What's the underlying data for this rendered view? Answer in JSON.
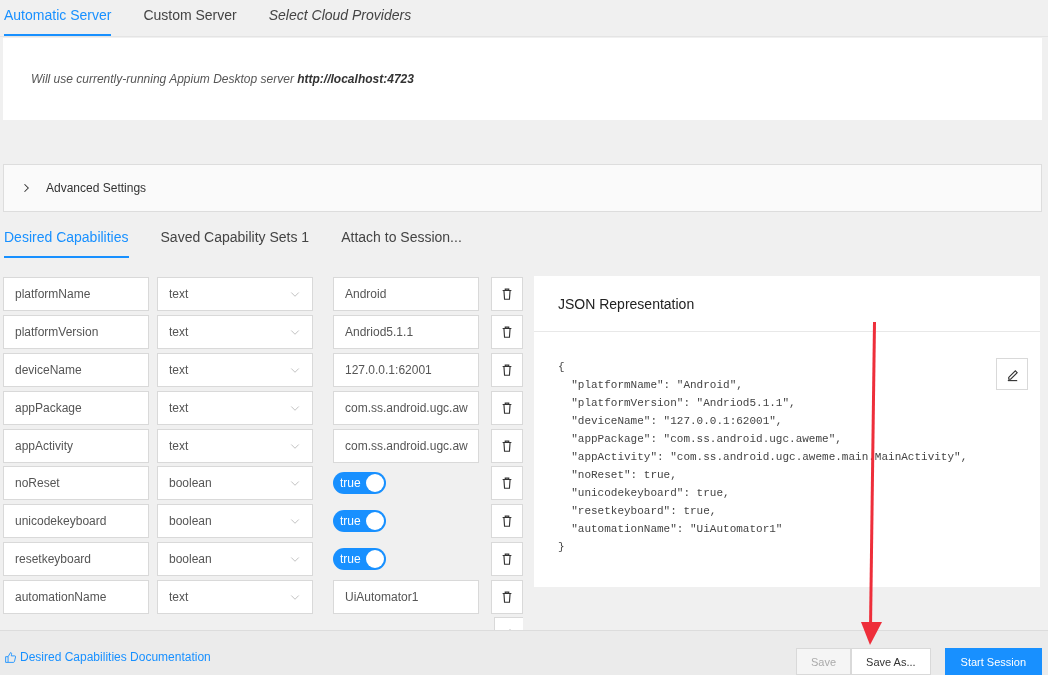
{
  "server_tabs": [
    {
      "label": "Automatic Server",
      "selected": true,
      "italic": false
    },
    {
      "label": "Custom Server",
      "selected": false,
      "italic": false
    },
    {
      "label": "Select Cloud Providers",
      "selected": false,
      "italic": true
    }
  ],
  "server_note": "Will use currently-running Appium Desktop server **http://localhost:4723**",
  "advanced_settings": {
    "label": "Advanced Settings",
    "expanded": false
  },
  "capability_tabs": [
    {
      "label": "Desired Capabilities",
      "selected": true
    },
    {
      "label": "Saved Capability Sets 1",
      "selected": false
    },
    {
      "label": "Attach to Session...",
      "selected": false
    }
  ],
  "capabilities": [
    {
      "name": "platformName",
      "type": "text",
      "kind": "field",
      "value": "Android"
    },
    {
      "name": "platformVersion",
      "type": "text",
      "kind": "field",
      "value": "Andriod5.1.1"
    },
    {
      "name": "deviceName",
      "type": "text",
      "kind": "field",
      "value": "127.0.0.1:62001"
    },
    {
      "name": "appPackage",
      "type": "text",
      "kind": "field",
      "value": "com.ss.android.ugc.aw"
    },
    {
      "name": "appActivity",
      "type": "text",
      "kind": "field",
      "value": "com.ss.android.ugc.aw"
    },
    {
      "name": "noReset",
      "type": "boolean",
      "kind": "switch",
      "value": "true",
      "on": true
    },
    {
      "name": "unicodekeyboard",
      "type": "boolean",
      "kind": "switch",
      "value": "true",
      "on": true
    },
    {
      "name": "resetkeyboard",
      "type": "boolean",
      "kind": "switch",
      "value": "true",
      "on": true
    },
    {
      "name": "automationName",
      "type": "text",
      "kind": "field",
      "value": "UiAutomator1"
    }
  ],
  "json_panel": {
    "title": "JSON Representation",
    "lines": [
      "{",
      "  \"platformName\": \"Android\",",
      "  \"platformVersion\": \"Andriod5.1.1\",",
      "  \"deviceName\": \"127.0.0.1:62001\",",
      "  \"appPackage\": \"com.ss.android.ugc.aweme\",",
      "  \"appActivity\": \"com.ss.android.ugc.aweme.main.MainActivity\",",
      "  \"noReset\": true,",
      "  \"unicodekeyboard\": true,",
      "  \"resetkeyboard\": true,",
      "  \"automationName\": \"UiAutomator1\"",
      "}"
    ]
  },
  "footer": {
    "doc_link": "Desired Capabilities Documentation",
    "buttons": [
      {
        "label": "Save",
        "kind": "plain",
        "disabled": true
      },
      {
        "label": "Save As...",
        "kind": "plain",
        "disabled": false
      },
      {
        "label": "Start Session",
        "kind": "primary",
        "disabled": false
      }
    ]
  },
  "annotations": [
    {
      "kind": "arrow"
    }
  ]
}
